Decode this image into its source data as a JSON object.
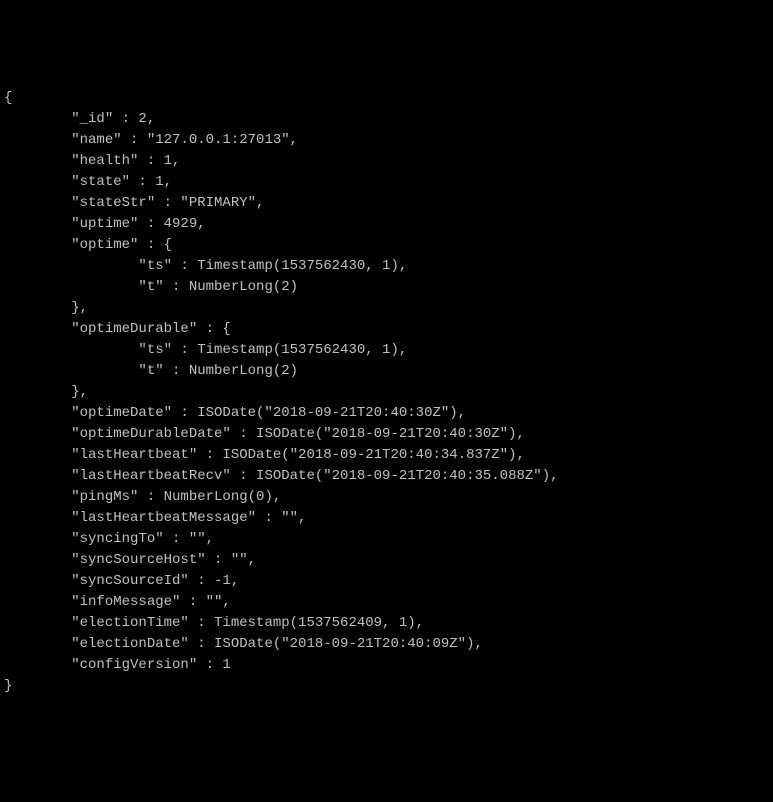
{
  "json_output": {
    "open_brace": "{",
    "id_line": "        \"_id\" : 2,",
    "name_line": "        \"name\" : \"127.0.0.1:27013\",",
    "health_line": "        \"health\" : 1,",
    "state_line": "        \"state\" : 1,",
    "statestr_line": "        \"stateStr\" : \"PRIMARY\",",
    "uptime_line": "        \"uptime\" : 4929,",
    "optime_line": "        \"optime\" : {",
    "optime_ts_line": "                \"ts\" : Timestamp(1537562430, 1),",
    "optime_t_line": "                \"t\" : NumberLong(2)",
    "optime_close_line": "        },",
    "optimedurable_line": "        \"optimeDurable\" : {",
    "optimedurable_ts_line": "                \"ts\" : Timestamp(1537562430, 1),",
    "optimedurable_t_line": "                \"t\" : NumberLong(2)",
    "optimedurable_close_line": "        },",
    "optimedate_line": "        \"optimeDate\" : ISODate(\"2018-09-21T20:40:30Z\"),",
    "optimedurabledate_line": "        \"optimeDurableDate\" : ISODate(\"2018-09-21T20:40:30Z\"),",
    "lastheartbeat_line": "        \"lastHeartbeat\" : ISODate(\"2018-09-21T20:40:34.837Z\"),",
    "lastheartbeatrecv_line": "        \"lastHeartbeatRecv\" : ISODate(\"2018-09-21T20:40:35.088Z\"),",
    "pingms_line": "        \"pingMs\" : NumberLong(0),",
    "lastheartbeatmessage_line": "        \"lastHeartbeatMessage\" : \"\",",
    "syncingto_line": "        \"syncingTo\" : \"\",",
    "syncsourcehost_line": "        \"syncSourceHost\" : \"\",",
    "syncsourceid_line": "        \"syncSourceId\" : -1,",
    "infomessage_line": "        \"infoMessage\" : \"\",",
    "electiontime_line": "        \"electionTime\" : Timestamp(1537562409, 1),",
    "electiondate_line": "        \"electionDate\" : ISODate(\"2018-09-21T20:40:09Z\"),",
    "configversion_line": "        \"configVersion\" : 1",
    "close_brace": "}"
  }
}
